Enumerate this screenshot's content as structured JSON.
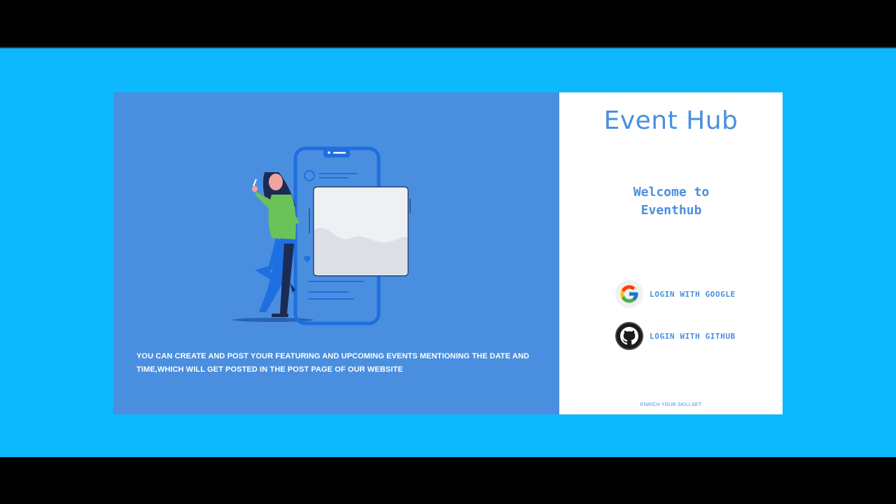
{
  "left": {
    "description": "YOU CAN CREATE AND POST YOUR FEATURING AND UPCOMING EVENTS MENTIONING THE DATE AND TIME,WHICH WILL GET POSTED IN THE POST PAGE OF OUR WEBSITE",
    "illustration": "person-with-phone-illustration"
  },
  "right": {
    "title": "Event Hub",
    "welcome_line1": "Welcome to",
    "welcome_line2": "Eventhub",
    "google_label": "LOGIN WITH GOOGLE",
    "github_label": "LOGIN WITH GITHUB",
    "footer": "ENRICH YOUR SKILLSET"
  },
  "icons": {
    "google": "google-icon",
    "github": "github-icon"
  },
  "colors": {
    "page_background": "#0db8fd",
    "left_panel": "#4a8fdf",
    "accent_text": "#4a8fdf",
    "right_panel": "#ffffff",
    "letterbox": "#000000"
  }
}
